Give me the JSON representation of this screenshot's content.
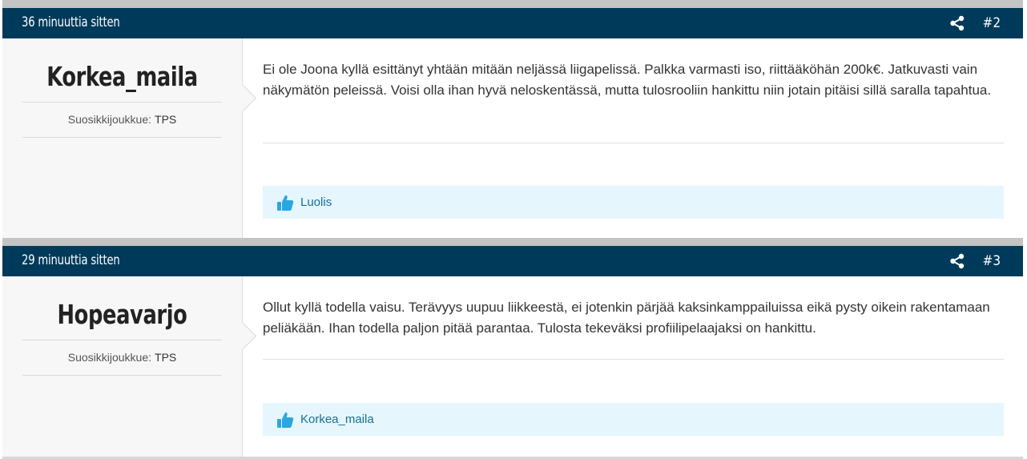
{
  "posts": [
    {
      "timestamp": "36 minuuttia sitten",
      "number": "#2",
      "author": "Korkea_maila",
      "fav_label": "Suosikkijoukkue:",
      "fav_team": "TPS",
      "content": "Ei ole Joona kyllä esittänyt yhtään mitään neljässä liigapelissä. Palkka varmasti iso, riittääköhän 200k€. Jatkuvasti vain näkymätön peleissä. Voisi olla ihan hyvä neloskentässä, mutta tulosrooliin hankittu niin jotain pitäisi sillä saralla tapahtua.",
      "likes": [
        "Luolis"
      ]
    },
    {
      "timestamp": "29 minuuttia sitten",
      "number": "#3",
      "author": "Hopeavarjo",
      "fav_label": "Suosikkijoukkue:",
      "fav_team": "TPS",
      "content": "Ollut kyllä todella vaisu. Terävyys uupuu liikkeestä, ei jotenkin pärjää kaksinkamppailuissa eikä pysty oikein rakentamaan peliäkään. Ihan todella paljon pitää parantaa. Tulosta tekeväksi profiilipelaajaksi on hankittu.",
      "likes": [
        "Korkea_maila"
      ]
    }
  ],
  "icons": {
    "share": "share-icon",
    "like": "thumbs-up-icon"
  },
  "colors": {
    "header": "#003a5a",
    "like_bg": "#e5f6fd",
    "like_text": "#1a6e96",
    "thumb": "#2aa7e0"
  }
}
